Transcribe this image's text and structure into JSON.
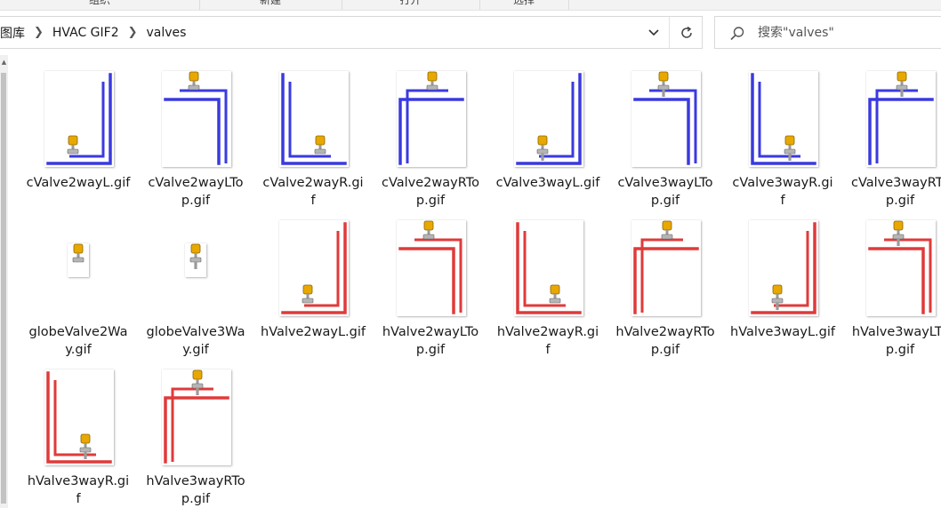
{
  "ribbon": {
    "groups": [
      "组织",
      "新建",
      "打开",
      "选择"
    ]
  },
  "address_bar": {
    "breadcrumbs": [
      "图库",
      "HVAC GIF2",
      "valves"
    ]
  },
  "search": {
    "placeholder": "搜索\"valves\""
  },
  "files": [
    {
      "name": "cValve2wayL.gif",
      "line1": "cValve2wayL.gif",
      "line2": "",
      "type": "cL",
      "color": "blue"
    },
    {
      "name": "cValve2wayLTop.gif",
      "line1": "cValve2wayLTo",
      "line2": "p.gif",
      "type": "cLTop",
      "color": "blue"
    },
    {
      "name": "cValve2wayR.gif",
      "line1": "cValve2wayR.gi",
      "line2": "f",
      "type": "cR",
      "color": "blue"
    },
    {
      "name": "cValve2wayRTop.gif",
      "line1": "cValve2wayRTo",
      "line2": "p.gif",
      "type": "cRTop",
      "color": "blue"
    },
    {
      "name": "cValve3wayL.gif",
      "line1": "cValve3wayL.gif",
      "line2": "",
      "type": "cL3",
      "color": "blue"
    },
    {
      "name": "cValve3wayLTop.gif",
      "line1": "cValve3wayLTo",
      "line2": "p.gif",
      "type": "cLTop3",
      "color": "blue"
    },
    {
      "name": "cValve3wayR.gif",
      "line1": "cValve3wayR.gi",
      "line2": "f",
      "type": "cR3",
      "color": "blue"
    },
    {
      "name": "cValve3wayRTop.gif",
      "line1": "cValve3wayRTo",
      "line2": "p.gif",
      "type": "cRTop3",
      "color": "blue"
    },
    {
      "name": "globeValve2Way.gif",
      "line1": "globeValve2Wa",
      "line2": "y.gif",
      "type": "globe2",
      "color": "none"
    },
    {
      "name": "globeValve3Way.gif",
      "line1": "globeValve3Wa",
      "line2": "y.gif",
      "type": "globe3",
      "color": "none"
    },
    {
      "name": "hValve2wayL.gif",
      "line1": "hValve2wayL.gif",
      "line2": "",
      "type": "cL",
      "color": "red"
    },
    {
      "name": "hValve2wayLTop.gif",
      "line1": "hValve2wayLTo",
      "line2": "p.gif",
      "type": "cLTop",
      "color": "red"
    },
    {
      "name": "hValve2wayR.gif",
      "line1": "hValve2wayR.gi",
      "line2": "f",
      "type": "cR",
      "color": "red"
    },
    {
      "name": "hValve2wayRTop.gif",
      "line1": "hValve2wayRTo",
      "line2": "p.gif",
      "type": "cRTop",
      "color": "red"
    },
    {
      "name": "hValve3wayL.gif",
      "line1": "hValve3wayL.gif",
      "line2": "",
      "type": "cL3",
      "color": "red"
    },
    {
      "name": "hValve3wayLTop.gif",
      "line1": "hValve3wayLTo",
      "line2": "p.gif",
      "type": "cLTop3",
      "color": "red"
    },
    {
      "name": "hValve3wayR.gif",
      "line1": "hValve3wayR.gi",
      "line2": "f",
      "type": "cR3",
      "color": "red"
    },
    {
      "name": "hValve3wayRTop.gif",
      "line1": "hValve3wayRTo",
      "line2": "p.gif",
      "type": "cRTop3",
      "color": "red"
    }
  ],
  "colors": {
    "blue_pipe": "#3a3ae0",
    "red_pipe": "#e03a3a",
    "valve_gold": "#e8a800",
    "valve_gray": "#9a9a9a"
  },
  "icons": {
    "chevron": "chevron-right-icon",
    "dropdown": "chevron-down-icon",
    "refresh": "refresh-icon",
    "search": "search-icon"
  }
}
